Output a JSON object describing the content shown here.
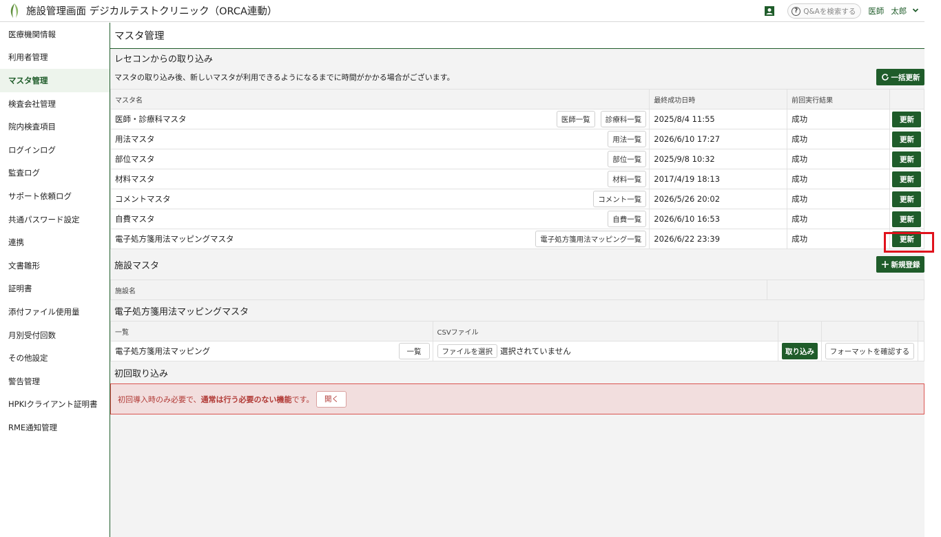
{
  "header": {
    "title": "施設管理画面 デジカルテストクリニック（ORCA連動）",
    "search_placeholder": "Q&Aを検索する",
    "user_role": "医師",
    "user_name": "太郎"
  },
  "sidebar": {
    "items": [
      {
        "label": "医療機関情報"
      },
      {
        "label": "利用者管理"
      },
      {
        "label": "マスタ管理",
        "active": true
      },
      {
        "label": "検査会社管理"
      },
      {
        "label": "院内検査項目"
      },
      {
        "label": "ログインログ"
      },
      {
        "label": "監査ログ"
      },
      {
        "label": "サポート依頼ログ"
      },
      {
        "label": "共通パスワード設定"
      },
      {
        "label": "連携"
      },
      {
        "label": "文書雛形"
      },
      {
        "label": "証明書"
      },
      {
        "label": "添付ファイル使用量"
      },
      {
        "label": "月別受付回数"
      },
      {
        "label": "その他設定"
      },
      {
        "label": "警告管理"
      },
      {
        "label": "HPKIクライアント証明書"
      },
      {
        "label": "RME通知管理"
      }
    ]
  },
  "main": {
    "page_title": "マスタ管理",
    "receipt_section": {
      "title": "レセコンからの取り込み",
      "note": "マスタの取り込み後、新しいマスタが利用できるようになるまでに時間がかかる場合がございます。",
      "bulk_update_label": "一括更新",
      "columns": [
        "マスタ名",
        "最終成功日時",
        "前回実行結果"
      ],
      "update_label": "更新",
      "rows": [
        {
          "name": "医師・診療科マスタ",
          "buttons": [
            "医師一覧",
            "診療科一覧"
          ],
          "date": "2025/8/4 11:55",
          "result": "成功"
        },
        {
          "name": "用法マスタ",
          "buttons": [
            "用法一覧"
          ],
          "date": "2026/6/10 17:27",
          "result": "成功"
        },
        {
          "name": "部位マスタ",
          "buttons": [
            "部位一覧"
          ],
          "date": "2025/9/8 10:32",
          "result": "成功"
        },
        {
          "name": "材料マスタ",
          "buttons": [
            "材料一覧"
          ],
          "date": "2017/4/19 18:13",
          "result": "成功"
        },
        {
          "name": "コメントマスタ",
          "buttons": [
            "コメント一覧"
          ],
          "date": "2026/5/26 20:02",
          "result": "成功"
        },
        {
          "name": "自費マスタ",
          "buttons": [
            "自費一覧"
          ],
          "date": "2026/6/10 16:53",
          "result": "成功"
        },
        {
          "name": "電子処方箋用法マッピングマスタ",
          "buttons": [
            "電子処方箋用法マッピング一覧"
          ],
          "date": "2026/6/22 23:39",
          "result": "成功"
        }
      ]
    },
    "facility_section": {
      "title": "施設マスタ",
      "new_label": "新規登録",
      "columns": [
        "施設名"
      ]
    },
    "mapping_section": {
      "title": "電子処方箋用法マッピングマスタ",
      "columns": [
        "一覧",
        "CSVファイル"
      ],
      "row_name": "電子処方箋用法マッピング",
      "list_label": "一覧",
      "file_button_label": "ファイルを選択",
      "file_status": "選択されていません",
      "import_label": "取り込み",
      "format_label": "フォーマットを確認する"
    },
    "initial_section": {
      "title": "初回取り込み",
      "alert_prefix": "初回導入時のみ必要で、",
      "alert_bold": "通常は行う必要のない機能",
      "alert_suffix": "です。",
      "open_label": "開く"
    }
  },
  "colors": {
    "brand_green": "#1f5c2a",
    "highlight_red": "#e0121c",
    "alert_bg": "#f2dede"
  }
}
